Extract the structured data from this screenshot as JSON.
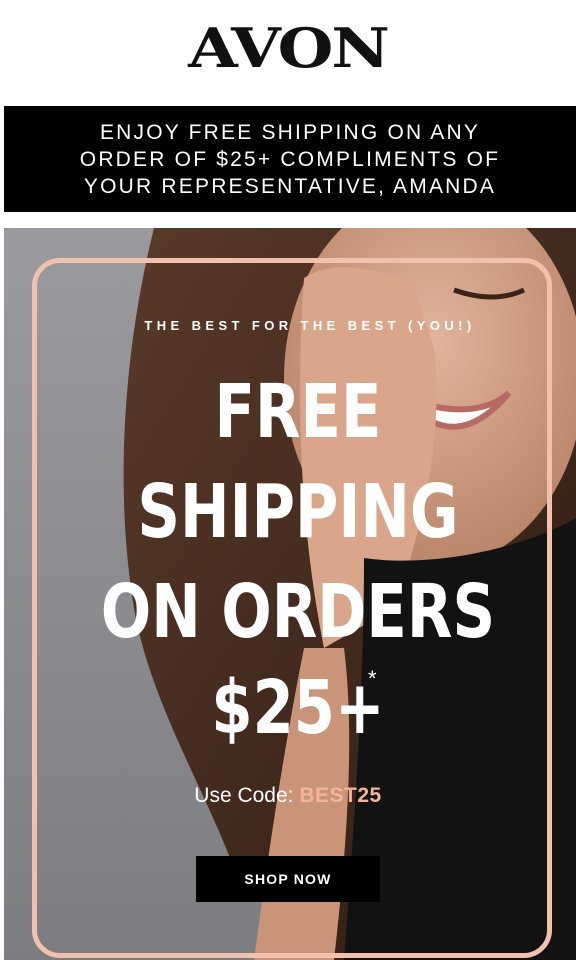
{
  "header": {
    "logo_text": "AVON"
  },
  "promo_banner": {
    "lines": [
      "ENJOY FREE SHIPPING ON ANY",
      "ORDER OF $25+ COMPLIMENTS OF",
      "YOUR REPRESENTATIVE, AMANDA"
    ]
  },
  "hero": {
    "tagline": "THE BEST FOR THE BEST (YOU!)",
    "headline_lines": [
      "FREE",
      "SHIPPING",
      "ON ORDERS",
      "$25+"
    ],
    "asterisk": "*",
    "code_label": "Use Code: ",
    "code_value": "BEST25",
    "cta_label": "SHOP NOW",
    "frame_color": "#f2c1ad",
    "code_color": "#f4b49c"
  }
}
